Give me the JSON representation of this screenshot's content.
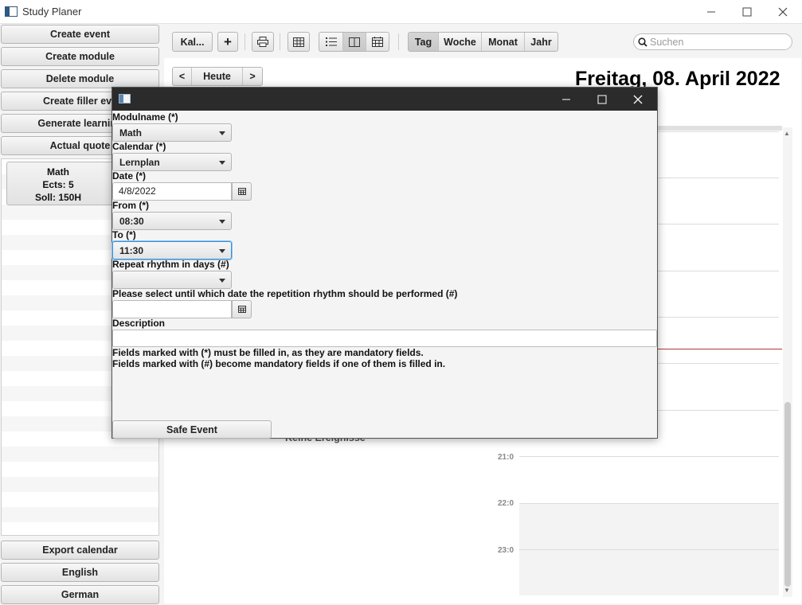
{
  "window": {
    "title": "Study Planer"
  },
  "sidebar": {
    "buttons": [
      {
        "label": "Create event"
      },
      {
        "label": "Create module"
      },
      {
        "label": "Delete module"
      },
      {
        "label": "Create filler eve"
      },
      {
        "label": "Generate learning"
      },
      {
        "label": "Actual quote"
      }
    ],
    "module_card": {
      "name": "Math",
      "ects": "Ects: 5",
      "target": "Soll: 150H"
    },
    "bottom_buttons": [
      {
        "label": "Export calendar"
      },
      {
        "label": "English"
      },
      {
        "label": "German"
      }
    ]
  },
  "toolbar": {
    "calendar_label": "Kal...",
    "add_symbol": "+",
    "views": [
      "Tag",
      "Woche",
      "Monat",
      "Jahr"
    ],
    "active_view": "Tag",
    "search_placeholder": "Suchen"
  },
  "navigation": {
    "prev": "<",
    "today": "Heute",
    "next": ">"
  },
  "calendar": {
    "date_title": "Freitag, 08. April 2022",
    "empty_text": "Keine Ereignisse",
    "hours": [
      "21:0",
      "22:0",
      "23:0"
    ]
  },
  "dialog": {
    "fields": {
      "module": {
        "label": "Modulname (*)",
        "value": "Math"
      },
      "calendar": {
        "label": "Calendar (*)",
        "value": "Lernplan"
      },
      "date": {
        "label": "Date (*)",
        "value": "4/8/2022"
      },
      "from": {
        "label": "From (*)",
        "value": "08:30"
      },
      "to": {
        "label": "To (*)",
        "value": "11:30"
      },
      "repeat": {
        "label": "Repeat rhythm in days (#)",
        "value": ""
      },
      "until": {
        "label": "Please select until which date the repetition rhythm should be performed (#)",
        "value": ""
      },
      "description": {
        "label": "Description",
        "value": ""
      }
    },
    "notes": [
      "Fields marked with (*) must be filled in, as they are mandatory fields.",
      "Fields marked with (#) become mandatory fields if one of them is filled in."
    ],
    "save_label": "Safe Event"
  }
}
